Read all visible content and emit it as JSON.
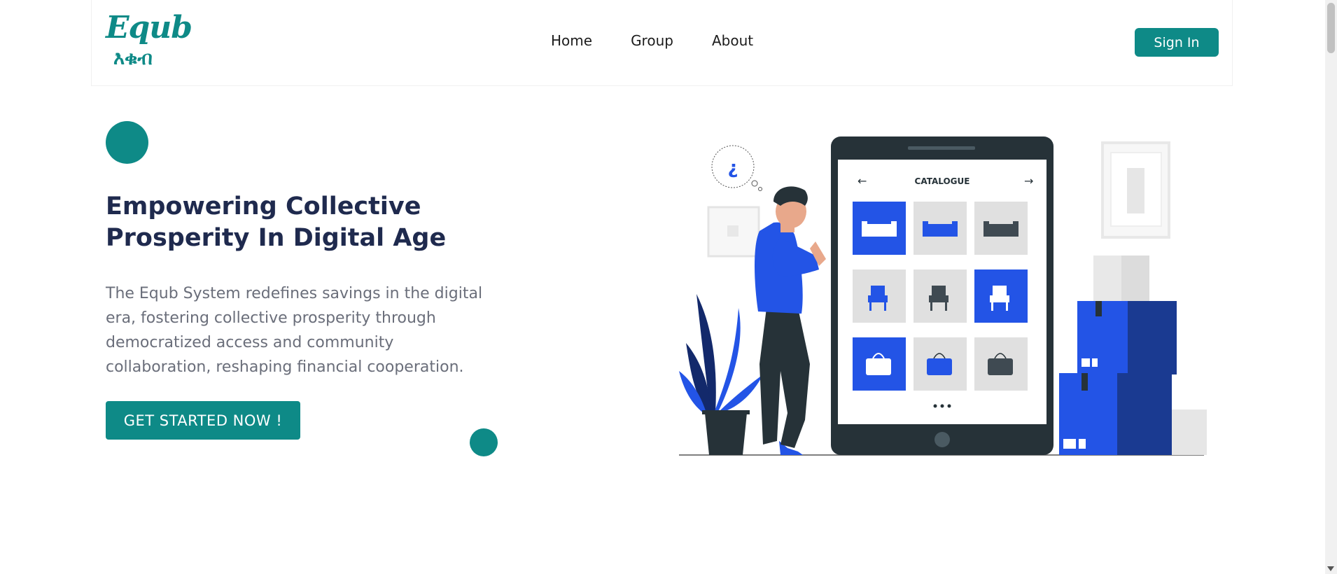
{
  "brand": {
    "logo_latin": "Equb",
    "logo_amharic": "እቁብ",
    "accent_color": "#0e8a87",
    "heading_color": "#1f2a4e"
  },
  "nav": {
    "items": [
      {
        "label": "Home"
      },
      {
        "label": "Group"
      },
      {
        "label": "About"
      }
    ],
    "signin_label": "Sign In"
  },
  "hero": {
    "title": "Empowering Collective Prosperity In Digital Age",
    "description": "The Equb System redefines savings in the digital era, fostering collective prosperity through democratized access and community collaboration, reshaping financial cooperation.",
    "cta_label": "GET STARTED NOW !"
  },
  "illustration": {
    "screen_title": "CATALOGUE",
    "question_mark": "¿",
    "accent_blue": "#2354e6"
  }
}
